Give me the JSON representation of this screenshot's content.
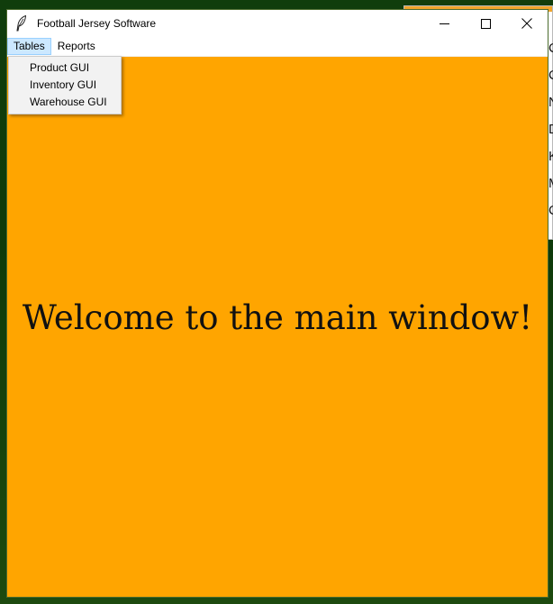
{
  "window": {
    "title": "Football Jersey Software",
    "app_icon": "feather-icon",
    "controls": [
      "minimize-icon",
      "maximize-icon",
      "close-icon"
    ]
  },
  "menubar": {
    "items": [
      {
        "label": "Tables",
        "active": true
      },
      {
        "label": "Reports",
        "active": false
      }
    ]
  },
  "tables_menu": {
    "items": [
      {
        "label": "Product GUI"
      },
      {
        "label": "Inventory GUI"
      },
      {
        "label": "Warehouse GUI"
      }
    ]
  },
  "main": {
    "welcome_text": "Welcome to the main window!"
  },
  "background_window": {
    "visible_letters": [
      "C",
      "C",
      "N",
      "D",
      "K",
      "M",
      "C"
    ]
  },
  "colors": {
    "content_bg": "#ffa500",
    "menu_highlight": "#cce8ff",
    "desktop": "#103d0c"
  }
}
